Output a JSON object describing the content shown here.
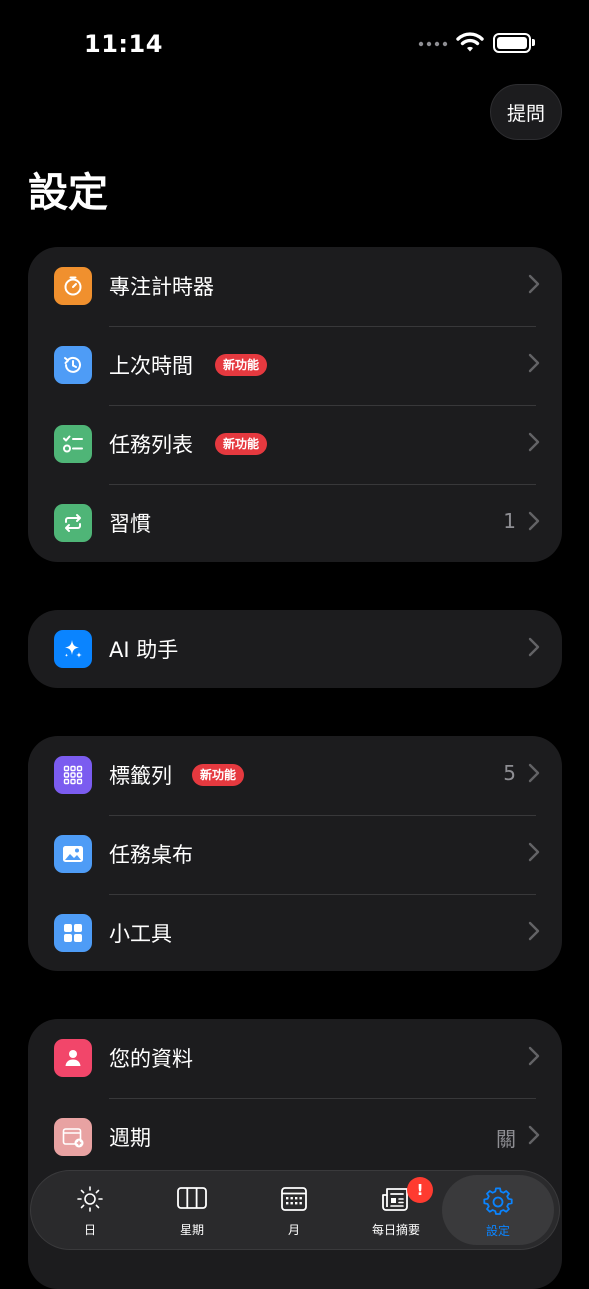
{
  "status": {
    "time": "11:14"
  },
  "header": {
    "ask_label": "提問",
    "title": "設定"
  },
  "groups": [
    {
      "rows": [
        {
          "label": "專注計時器",
          "icon": "timer-icon",
          "color": "#f0902e"
        },
        {
          "label": "上次時間",
          "badge": "新功能",
          "icon": "history-icon",
          "color": "#4e9cf6"
        },
        {
          "label": "任務列表",
          "badge": "新功能",
          "icon": "checklist-icon",
          "color": "#4fb577"
        },
        {
          "label": "習慣",
          "value": "1",
          "icon": "repeat-icon",
          "color": "#4fb577"
        }
      ]
    },
    {
      "rows": [
        {
          "label": "AI 助手",
          "icon": "sparkles-icon",
          "color": "#0a84ff"
        }
      ]
    },
    {
      "rows": [
        {
          "label": "標籤列",
          "badge": "新功能",
          "value": "5",
          "icon": "grid-dots-icon",
          "color": "#7b5cf0"
        },
        {
          "label": "任務桌布",
          "icon": "image-icon",
          "color": "#4e9cf6"
        },
        {
          "label": "小工具",
          "icon": "widgets-icon",
          "color": "#4e9cf6"
        }
      ]
    },
    {
      "rows": [
        {
          "label": "您的資料",
          "icon": "person-icon",
          "color": "#f2466a"
        },
        {
          "label": "週期",
          "value": "關",
          "icon": "calendar-plus-icon",
          "color": "#e8a2a2"
        }
      ]
    }
  ],
  "tabs": [
    {
      "label": "日",
      "icon": "sun-icon"
    },
    {
      "label": "星期",
      "icon": "week-columns-icon"
    },
    {
      "label": "月",
      "icon": "month-calendar-icon"
    },
    {
      "label": "每日摘要",
      "icon": "newspaper-icon",
      "badge": "!"
    },
    {
      "label": "設定",
      "icon": "gear-icon",
      "active": true
    }
  ],
  "colors": {
    "accent": "#0a84ff",
    "badge": "#e5393f",
    "card": "#1c1c1e",
    "background": "#000000"
  }
}
